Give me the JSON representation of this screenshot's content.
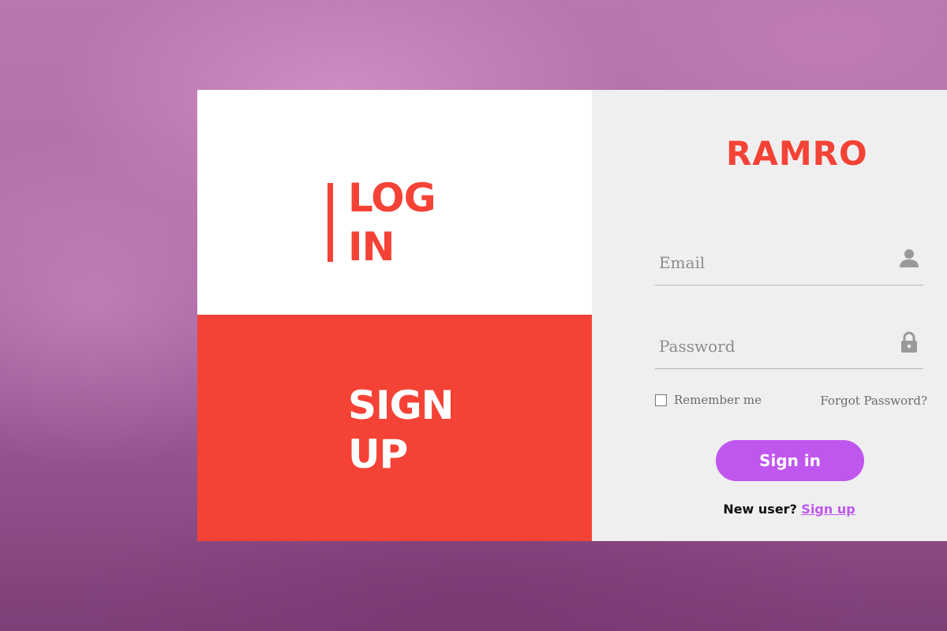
{
  "left_panel": {
    "login": {
      "line1": "LOG",
      "line2": "IN"
    },
    "signup": {
      "line1": "SIGN",
      "line2": "UP"
    }
  },
  "form": {
    "brand": "RAMRO",
    "email": {
      "placeholder": "Email",
      "value": "",
      "icon": "user-icon"
    },
    "password": {
      "placeholder": "Password",
      "value": "",
      "icon": "lock-icon"
    },
    "remember_label": "Remember me",
    "remember_checked": false,
    "forgot_label": "Forgot Password?",
    "signin_label": "Sign in",
    "new_user_text": "New user?",
    "signup_link": "Sign up"
  },
  "colors": {
    "accent_red": "#f44336",
    "accent_purple": "#bf57ee",
    "form_bg": "#efefef"
  }
}
